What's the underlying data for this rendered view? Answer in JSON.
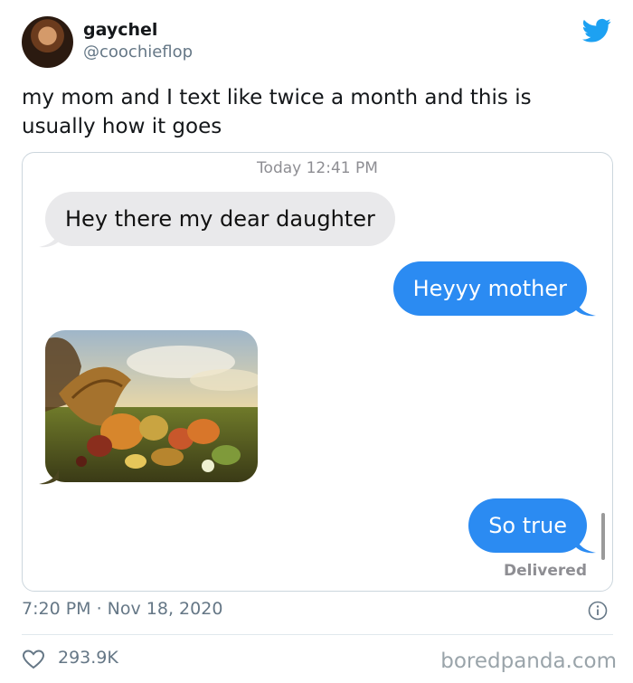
{
  "user": {
    "name": "gaychel",
    "handle": "@coochieflop"
  },
  "tweet": {
    "text": "my mom and I text like twice a month and this is usually how it goes"
  },
  "conversation": {
    "timestamp": "Today 12:41 PM",
    "messages": [
      {
        "from": "mom",
        "text": "Hey there my dear daughter"
      },
      {
        "from": "me",
        "text": "Heyyy mother"
      },
      {
        "from": "mom",
        "image": "cornucopia-painting"
      },
      {
        "from": "me",
        "text": "So true"
      }
    ],
    "status": "Delivered",
    "colors": {
      "incoming": "#e9e9eb",
      "outgoing": "#2b8bf2"
    }
  },
  "meta": {
    "posted": "7:20 PM · Nov 18, 2020",
    "likes": "293.9K"
  },
  "watermark": "boredpanda.com",
  "icons": [
    "twitter-bird-icon",
    "info-icon",
    "heart-icon"
  ],
  "colors": {
    "twitter_blue": "#1da1f2",
    "secondary_text": "#657786"
  }
}
